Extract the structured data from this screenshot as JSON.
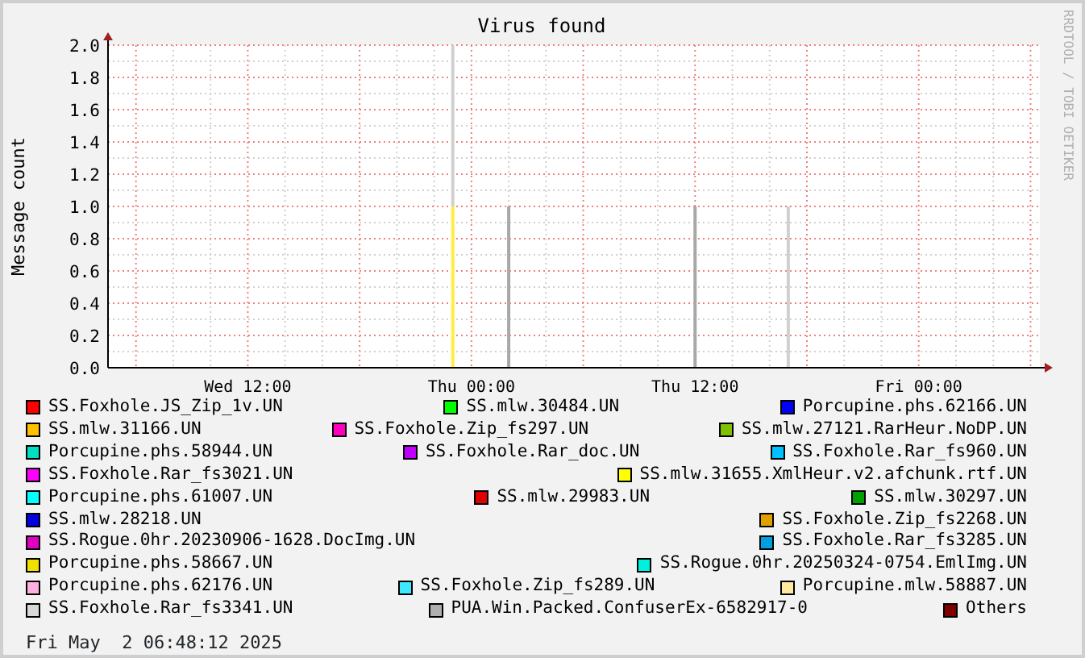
{
  "graph": {
    "title": "Virus found",
    "credit": "RRDTOOL / TOBI OETIKER",
    "chart_data": {
      "type": "bar",
      "stacked": true,
      "ylabel": "Message count",
      "ylim": [
        0,
        2
      ],
      "categories": [
        null,
        null,
        null,
        null,
        null,
        null,
        null,
        "Wed 12:00",
        null,
        null,
        null,
        null,
        null,
        null,
        null,
        null,
        null,
        null,
        null,
        "Thu 00:00",
        null,
        null,
        null,
        null,
        null,
        null,
        null,
        null,
        null,
        null,
        null,
        "Thu 12:00",
        null,
        null,
        null,
        null,
        null,
        null,
        null,
        null,
        null,
        null,
        null,
        "Fri 00:00",
        null,
        null,
        null,
        null,
        null,
        null
      ],
      "yticks": [
        {
          "value": 0,
          "label": "0.0"
        },
        {
          "value": 0.2,
          "label": "0.2"
        },
        {
          "value": 0.4,
          "label": "0.4"
        },
        {
          "value": 0.6,
          "label": "0.6"
        },
        {
          "value": 0.8,
          "label": "0.8"
        },
        {
          "value": 1,
          "label": "1.0"
        },
        {
          "value": 1.2,
          "label": "1.2"
        },
        {
          "value": 1.4,
          "label": "1.4"
        },
        {
          "value": 1.6,
          "label": "1.6"
        },
        {
          "value": 1.8,
          "label": "1.8"
        },
        {
          "value": 2,
          "label": "2.0"
        }
      ],
      "series": [
        {
          "color": "#ffee44",
          "values": [
            null,
            null,
            null,
            null,
            null,
            null,
            null,
            null,
            null,
            null,
            null,
            null,
            null,
            null,
            null,
            null,
            null,
            null,
            1,
            null,
            null,
            null,
            null,
            null,
            null,
            null,
            null,
            null,
            null,
            null,
            null,
            null,
            null,
            null,
            null,
            null,
            null,
            null,
            null,
            null,
            null,
            null,
            null,
            null,
            null,
            null,
            null,
            null,
            null,
            null
          ]
        },
        {
          "color": "#d0d0d0",
          "values": [
            null,
            null,
            null,
            null,
            null,
            null,
            null,
            null,
            null,
            null,
            null,
            null,
            null,
            null,
            null,
            null,
            null,
            null,
            1,
            null,
            null,
            null,
            null,
            null,
            null,
            null,
            null,
            null,
            null,
            null,
            null,
            null,
            null,
            null,
            null,
            null,
            1,
            null,
            null,
            null,
            null,
            null,
            null,
            null,
            null,
            null,
            null,
            null,
            null,
            null
          ]
        },
        {
          "color": "#a8a8a8",
          "values": [
            null,
            null,
            null,
            null,
            null,
            null,
            null,
            null,
            null,
            null,
            null,
            null,
            null,
            null,
            null,
            null,
            null,
            null,
            null,
            null,
            null,
            1,
            null,
            null,
            null,
            null,
            null,
            null,
            null,
            null,
            null,
            1,
            null,
            null,
            null,
            null,
            null,
            null,
            null,
            null,
            null,
            null,
            null,
            null,
            null,
            null,
            null,
            null,
            null,
            null
          ]
        }
      ]
    }
  },
  "legend": [
    [
      {
        "label": "SS.Foxhole.JS_Zip_1v.UN",
        "color": "#ff0000"
      },
      {
        "label": "SS.mlw.30484.UN",
        "color": "#00ff00"
      },
      {
        "label": "Porcupine.phs.62166.UN",
        "color": "#0000ff"
      }
    ],
    [
      {
        "label": "SS.mlw.31166.UN",
        "color": "#ffc000"
      },
      {
        "label": "SS.Foxhole.Zip_fs297.UN",
        "color": "#ff00c0"
      },
      {
        "label": "SS.mlw.27121.RarHeur.NoDP.UN",
        "color": "#80c000"
      }
    ],
    [
      {
        "label": "Porcupine.phs.58944.UN",
        "color": "#00e0c0"
      },
      {
        "label": "SS.Foxhole.Rar_doc.UN",
        "color": "#c000ff"
      },
      {
        "label": "SS.Foxhole.Rar_fs960.UN",
        "color": "#00c0ff"
      }
    ],
    [
      {
        "label": "SS.Foxhole.Rar_fs3021.UN",
        "color": "#ff00ff"
      },
      {
        "label": "SS.mlw.31655.XmlHeur.v2.afchunk.rtf.UN",
        "color": "#ffff00"
      }
    ],
    [
      {
        "label": "Porcupine.phs.61007.UN",
        "color": "#00ffff"
      },
      {
        "label": "SS.mlw.29983.UN",
        "color": "#e00000"
      },
      {
        "label": "SS.mlw.30297.UN",
        "color": "#00a000"
      }
    ],
    [
      {
        "label": "SS.mlw.28218.UN",
        "color": "#0000e0"
      },
      {
        "label": "SS.Foxhole.Zip_fs2268.UN",
        "color": "#e0a000"
      }
    ],
    [
      {
        "label": "SS.Rogue.0hr.20230906-1628.DocImg.UN",
        "color": "#e000c0"
      },
      {
        "label": "SS.Foxhole.Rar_fs3285.UN",
        "color": "#00a0e0"
      }
    ],
    [
      {
        "label": "Porcupine.phs.58667.UN",
        "color": "#f0e000"
      },
      {
        "label": "SS.Rogue.0hr.20250324-0754.EmlImg.UN",
        "color": "#00f0e0"
      }
    ],
    [
      {
        "label": "Porcupine.phs.62176.UN",
        "color": "#ffb0e0"
      },
      {
        "label": "SS.Foxhole.Zip_fs289.UN",
        "color": "#40e8ff"
      },
      {
        "label": "Porcupine.mlw.58887.UN",
        "color": "#ffe8a0"
      }
    ],
    [
      {
        "label": "SS.Foxhole.Rar_fs3341.UN",
        "color": "#d8d8d8"
      },
      {
        "label": "PUA.Win.Packed.ConfuserEx-6582917-0",
        "color": "#b0b0b0"
      },
      {
        "label": "Others",
        "color": "#800000"
      }
    ]
  ],
  "timestamp": "Fri May  2 06:48:12 2025"
}
